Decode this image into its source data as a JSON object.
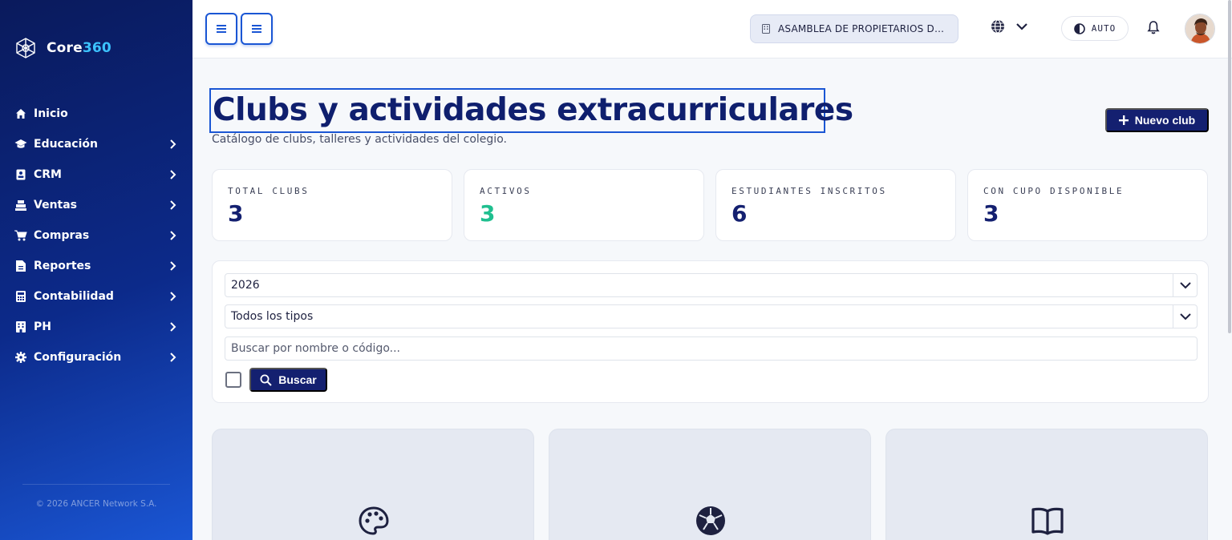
{
  "brand": {
    "name_prefix": "Core",
    "name_suffix": "360",
    "accent": "#3cc3ff"
  },
  "sidebar": {
    "items": [
      {
        "label": "Inicio",
        "icon": "home-icon",
        "has_chevron": false
      },
      {
        "label": "Educación",
        "icon": "graduation-cap-icon",
        "has_chevron": true
      },
      {
        "label": "CRM",
        "icon": "contact-card-icon",
        "has_chevron": true
      },
      {
        "label": "Ventas",
        "icon": "cash-register-icon",
        "has_chevron": true
      },
      {
        "label": "Compras",
        "icon": "shopping-cart-icon",
        "has_chevron": true
      },
      {
        "label": "Reportes",
        "icon": "file-report-icon",
        "has_chevron": true
      },
      {
        "label": "Contabilidad",
        "icon": "calculator-icon",
        "has_chevron": true
      },
      {
        "label": "PH",
        "icon": "building-icon",
        "has_chevron": true
      },
      {
        "label": "Configuración",
        "icon": "gear-icon",
        "has_chevron": true
      }
    ],
    "footer": "© 2026 ANCER Network S.A."
  },
  "topbar": {
    "org_name": "ASAMBLEA DE PROPIETARIOS DE ...",
    "theme_mode": "AUTO"
  },
  "page": {
    "title": "Clubs y actividades extracurriculares",
    "subtitle": "Catálogo de clubs, talleres y actividades del colegio.",
    "new_button": "Nuevo club"
  },
  "stats": [
    {
      "label": "TOTAL CLUBS",
      "value": "3",
      "color": "#142070"
    },
    {
      "label": "ACTIVOS",
      "value": "3",
      "color": "#1fbf8f"
    },
    {
      "label": "ESTUDIANTES INSCRITOS",
      "value": "6",
      "color": "#142070"
    },
    {
      "label": "CON CUPO DISPONIBLE",
      "value": "3",
      "color": "#142070"
    }
  ],
  "filters": {
    "year": "2026",
    "type": "Todos los tipos",
    "search_placeholder": "Buscar por nombre o código...",
    "search_button": "Buscar"
  },
  "cards": [
    {
      "icon": "palette-icon"
    },
    {
      "icon": "soccer-ball-icon"
    },
    {
      "icon": "open-book-icon"
    }
  ],
  "colors": {
    "primary": "#142070",
    "accent_blue": "#1a56d4",
    "success": "#1fbf8f"
  }
}
